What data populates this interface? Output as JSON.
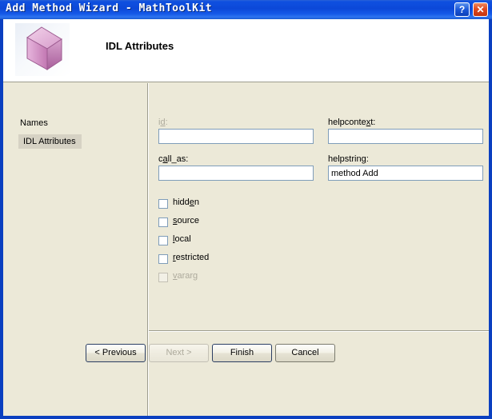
{
  "window": {
    "title": "Add Method Wizard - MathToolKit",
    "help_button_label": "?",
    "close_button_label": "✕",
    "border_color": "#0a3fc0",
    "titlebar_color": "#0c48d8",
    "client_bg": "#ece9d8"
  },
  "header": {
    "title": "IDL Attributes",
    "icon": "cube-icon",
    "icon_color": "#cf8fc4"
  },
  "sidebar": {
    "heading": "Names",
    "items": [
      {
        "label": "IDL Attributes",
        "selected": true
      }
    ],
    "selected_bg": "#d6d2c4"
  },
  "main": {
    "fields": [
      {
        "name": "id",
        "label_pre": "i",
        "label_key": "d",
        "label_post": ":",
        "value": "",
        "placeholder": "",
        "disabled": true
      },
      {
        "name": "call_as",
        "label_pre": "c",
        "label_key": "a",
        "label_post": "ll_as:",
        "value": "",
        "placeholder": "",
        "disabled": false
      },
      {
        "name": "helpcontext",
        "label_pre": "helpconte",
        "label_key": "x",
        "label_post": "t:",
        "value": "",
        "placeholder": "",
        "disabled": false
      },
      {
        "name": "helpstring",
        "label_pre": "helpstrin",
        "label_key": "g",
        "label_post": ":",
        "value": "method Add",
        "placeholder": "",
        "disabled": false
      }
    ],
    "checkboxes": [
      {
        "name": "hidden",
        "pre": "hidd",
        "key": "e",
        "post": "n",
        "checked": false,
        "disabled": false
      },
      {
        "name": "source",
        "pre": "",
        "key": "s",
        "post": "ource",
        "checked": false,
        "disabled": false
      },
      {
        "name": "local",
        "pre": "",
        "key": "l",
        "post": "ocal",
        "checked": false,
        "disabled": false
      },
      {
        "name": "restricted",
        "pre": "",
        "key": "r",
        "post": "estricted",
        "checked": false,
        "disabled": false
      },
      {
        "name": "vararg",
        "pre": "",
        "key": "v",
        "post": "ararg",
        "checked": false,
        "disabled": true
      }
    ]
  },
  "buttons": {
    "previous": {
      "label": "< Previous",
      "disabled": false,
      "default": true
    },
    "next": {
      "label": "Next >",
      "disabled": true,
      "default": false
    },
    "finish": {
      "label": "Finish",
      "disabled": false,
      "default": true
    },
    "cancel": {
      "label": "Cancel",
      "disabled": false,
      "default": false
    }
  }
}
